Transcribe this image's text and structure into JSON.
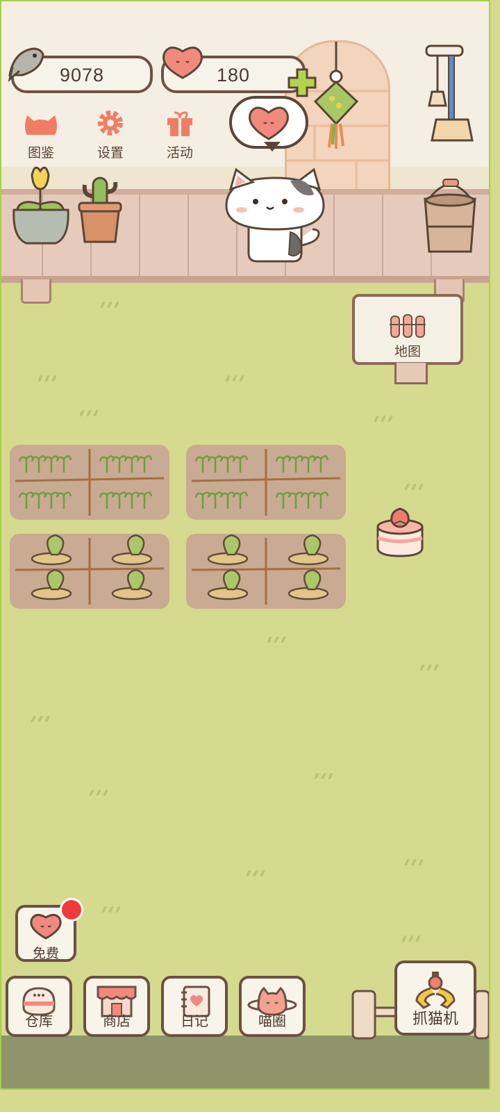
{
  "hud": {
    "fish_count": "9078",
    "heart_count": "180"
  },
  "menu": [
    {
      "label": "图鉴",
      "icon": "cat-head-icon"
    },
    {
      "label": "设置",
      "icon": "gear-icon"
    },
    {
      "label": "活动",
      "icon": "gift-icon"
    }
  ],
  "map_sign": {
    "label": "地图",
    "icon": "fence-gate-icon"
  },
  "free_button": {
    "label": "免费",
    "icon": "heart-icon"
  },
  "bottom_nav": [
    {
      "label": "仓库",
      "icon": "storage-icon"
    },
    {
      "label": "商店",
      "icon": "shop-icon"
    },
    {
      "label": "日记",
      "icon": "diary-icon"
    },
    {
      "label": "喵圈",
      "icon": "planet-cat-icon"
    }
  ],
  "claw_machine": {
    "label": "抓猫机",
    "icon": "claw-icon"
  },
  "colors": {
    "accent": "#f17a62",
    "grass": "#d5da8e",
    "outline": "#6b5142"
  }
}
